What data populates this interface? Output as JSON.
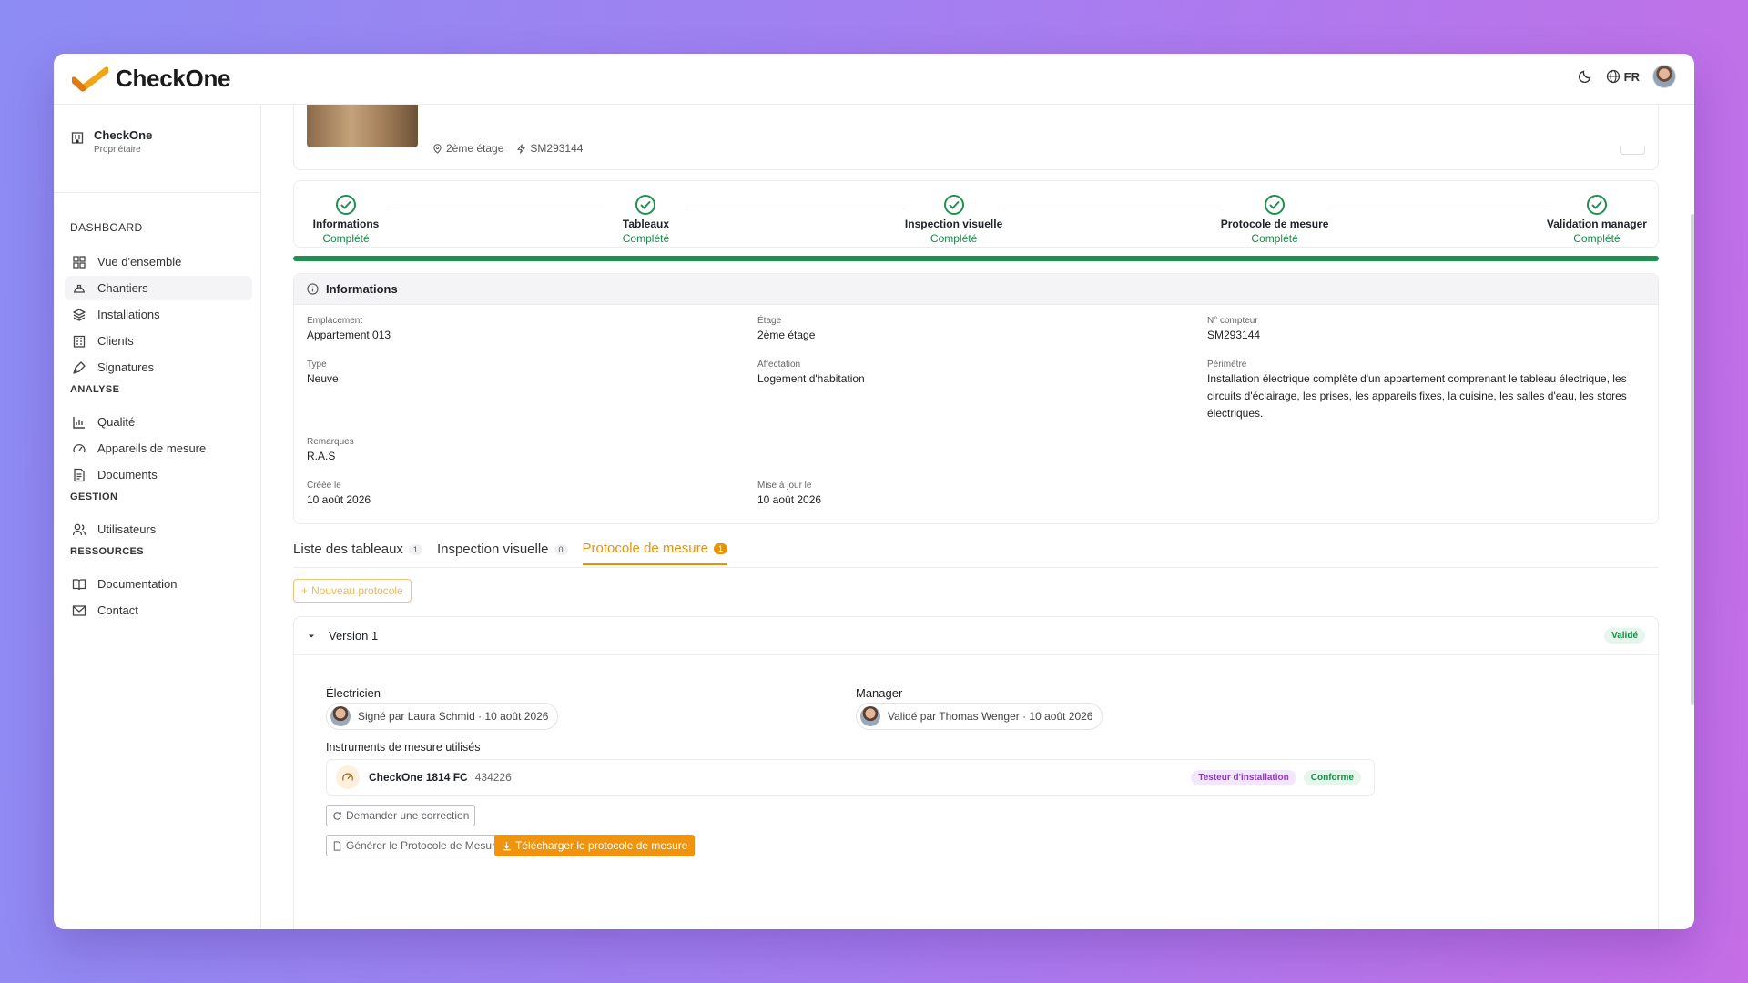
{
  "app": {
    "name": "CheckOne",
    "lang": "FR"
  },
  "org": {
    "name": "CheckOne",
    "role": "Propriétaire"
  },
  "sidebar": {
    "dashboard_label": "DASHBOARD",
    "dashboard_items": [
      "Vue d'ensemble",
      "Chantiers",
      "Installations",
      "Clients",
      "Signatures"
    ],
    "analyse_label": "ANALYSE",
    "analyse_items": [
      "Qualité",
      "Appareils de mesure",
      "Documents"
    ],
    "gestion_label": "GESTION",
    "gestion_items": [
      "Utilisateurs"
    ],
    "ressources_label": "RESSOURCES",
    "ressources_items": [
      "Documentation",
      "Contact"
    ]
  },
  "header": {
    "floor": "2ème étage",
    "meter": "SM293144"
  },
  "steps": [
    {
      "title": "Informations",
      "status": "Complété"
    },
    {
      "title": "Tableaux",
      "status": "Complété"
    },
    {
      "title": "Inspection visuelle",
      "status": "Complété"
    },
    {
      "title": "Protocole de mesure",
      "status": "Complété"
    },
    {
      "title": "Validation manager",
      "status": "Complété"
    }
  ],
  "progress": 1.0,
  "info": {
    "title": "Informations",
    "emplacement_label": "Emplacement",
    "emplacement": "Appartement 013",
    "etage_label": "Étage",
    "etage": "2ème étage",
    "compteur_label": "N° compteur",
    "compteur": "SM293144",
    "type_label": "Type",
    "type": "Neuve",
    "affectation_label": "Affectation",
    "affectation": "Logement d'habitation",
    "perimetre_label": "Périmètre",
    "perimetre": "Installation électrique complète d'un appartement comprenant le tableau électrique, les circuits d'éclairage, les prises, les appareils fixes, la cuisine, les salles d'eau, les stores électriques.",
    "remarques_label": "Remarques",
    "remarques": "R.A.S",
    "cree_label": "Créée le",
    "cree": "10 août 2026",
    "maj_label": "Mise à jour le",
    "maj": "10 août 2026"
  },
  "tabs": [
    {
      "label": "Liste des tableaux",
      "count": "1"
    },
    {
      "label": "Inspection visuelle",
      "count": "0"
    },
    {
      "label": "Protocole de mesure",
      "count": "1"
    }
  ],
  "new_protocol": "Nouveau protocole",
  "version": {
    "label": "Version 1",
    "status": "Validé",
    "electricien_label": "Électricien",
    "electricien_sig": "Signé par Laura Schmid · 10 août 2026",
    "manager_label": "Manager",
    "manager_sig": "Validé par Thomas Wenger · 10 août 2026",
    "instruments_label": "Instruments de mesure utilisés",
    "instrument_name": "CheckOne 1814 FC",
    "instrument_serial": "434226",
    "instrument_type": "Testeur d'installation",
    "instrument_status": "Conforme",
    "btn_correction": "Demander une correction",
    "btn_generate": "Générer le Protocole de Mesure",
    "btn_download": "Télécharger le protocole de mesure"
  },
  "colors": {
    "accent": "#e8920c",
    "success": "#1f8f52",
    "bg_gradient": [
      "#8d8cf4",
      "#c56ee6"
    ]
  }
}
